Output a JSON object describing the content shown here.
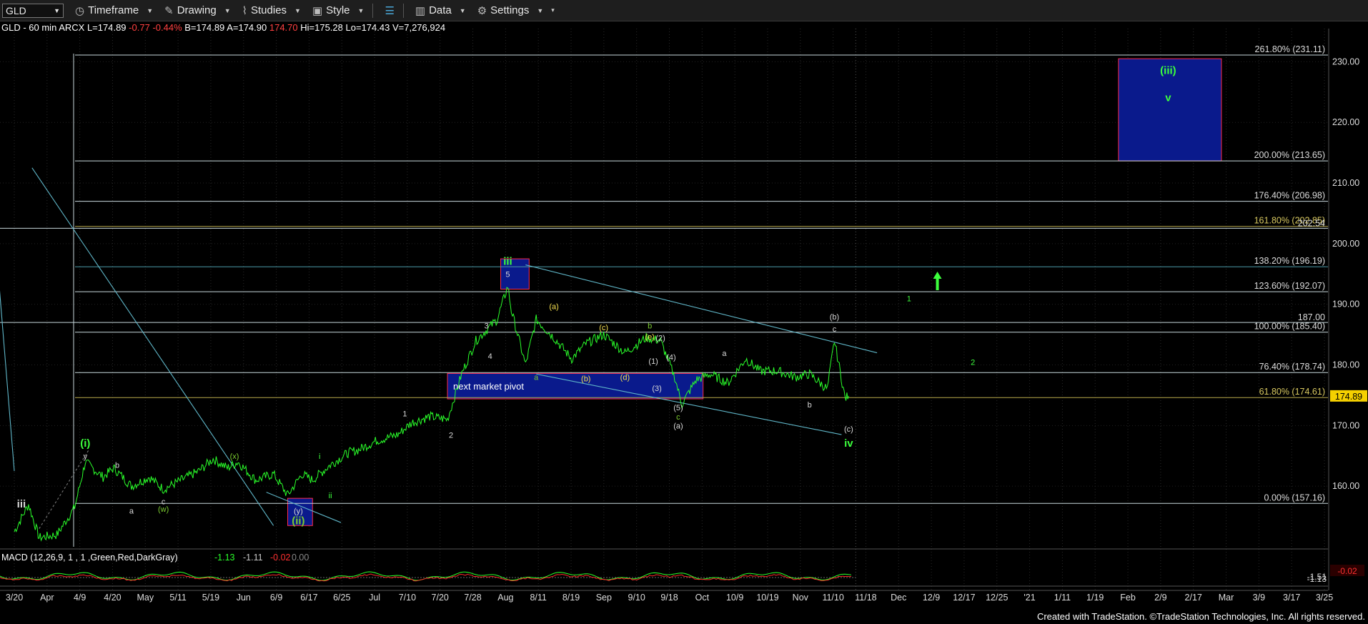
{
  "toolbar": {
    "symbol": "GLD",
    "items": [
      {
        "label": "Timeframe",
        "icon": "clock-icon"
      },
      {
        "label": "Drawing",
        "icon": "pencil-icon"
      },
      {
        "label": "Studies",
        "icon": "studies-icon"
      },
      {
        "label": "Style",
        "icon": "style-icon"
      },
      {
        "label": "Data",
        "icon": "data-icon"
      },
      {
        "label": "Settings",
        "icon": "gear-icon"
      }
    ]
  },
  "quote": {
    "symbol_interval": "GLD - 60 min  ARCX",
    "last": "L=174.89",
    "change": "-0.77",
    "change_pct": "-0.44%",
    "bid": "B=174.89",
    "ask": "A=174.90",
    "last2": "174.70",
    "high": "Hi=175.28",
    "low": "Lo=174.43",
    "volume": "V=7,276,924"
  },
  "colors": {
    "background": "#000000",
    "trendline": "#5fb6c8",
    "fib_line": "#c8d8dc",
    "fib_gold": "#b8a84a",
    "box_fill": "#0a1a8c",
    "box_border": "#ff2a4a",
    "price": "#2aff2a",
    "wave_green": "#3cff3c",
    "wave_olive": "#7ccd30",
    "wave_white": "#d8d8d8",
    "wave_yellow": "#f5e050",
    "macd_green": "#2aff2a",
    "macd_red": "#ff2a2a",
    "last_price_box": "#f5d000"
  },
  "chart_data": {
    "type": "line",
    "title": "",
    "timeframe": "60 min",
    "xlabel": "",
    "ylabel": "",
    "ylim": [
      150,
      235
    ],
    "y_ticks": [
      "160.00",
      "170.00",
      "180.00",
      "190.00",
      "200.00",
      "210.00",
      "220.00",
      "230.00"
    ],
    "x_tick_labels": [
      "3/20",
      "Apr",
      "4/9",
      "4/20",
      "May",
      "5/11",
      "5/19",
      "Jun",
      "6/9",
      "6/17",
      "6/25",
      "Jul",
      "7/10",
      "7/20",
      "7/28",
      "Aug",
      "8/11",
      "8/19",
      "Sep",
      "9/10",
      "9/18",
      "Oct",
      "10/9",
      "10/19",
      "Nov",
      "11/10",
      "11/18",
      "Dec",
      "12/9",
      "12/17",
      "12/25",
      "'21",
      "1/11",
      "1/19",
      "Feb",
      "2/9",
      "2/17",
      "Mar",
      "3/9",
      "3/17",
      "3/25"
    ],
    "last_price": "174.89",
    "series": [
      {
        "name": "GLD",
        "x": [
          "3/20",
          "3/24",
          "3/27",
          "4/1",
          "4/6",
          "4/9",
          "4/14",
          "4/17",
          "4/22",
          "4/27",
          "5/1",
          "5/6",
          "5/11",
          "5/15",
          "5/19",
          "5/22",
          "5/27",
          "6/1",
          "6/5",
          "6/9",
          "6/12",
          "6/17",
          "6/22",
          "6/25",
          "6/30",
          "7/6",
          "7/10",
          "7/15",
          "7/20",
          "7/24",
          "7/28",
          "8/3",
          "8/6",
          "8/7",
          "8/11",
          "8/14",
          "8/19",
          "8/24",
          "8/28",
          "9/2",
          "9/8",
          "9/14",
          "9/18",
          "9/22",
          "9/24",
          "9/28",
          "10/2",
          "10/7",
          "10/12",
          "10/16",
          "10/21",
          "10/26",
          "10/30",
          "11/4",
          "11/6",
          "11/9",
          "11/10"
        ],
        "values": [
          152.5,
          157.0,
          151.5,
          152.0,
          156.5,
          164.0,
          161.5,
          163.0,
          160.0,
          161.5,
          159.5,
          161.0,
          162.5,
          164.5,
          163.0,
          164.0,
          161.0,
          162.0,
          158.5,
          162.0,
          161.0,
          163.5,
          165.5,
          166.0,
          167.5,
          168.5,
          170.5,
          171.5,
          171.0,
          178.5,
          184.0,
          187.5,
          193.0,
          189.0,
          180.0,
          187.5,
          184.5,
          181.0,
          183.5,
          185.0,
          182.0,
          184.5,
          184.0,
          178.0,
          173.5,
          177.5,
          178.5,
          177.0,
          181.0,
          179.0,
          179.0,
          178.0,
          178.5,
          176.0,
          184.0,
          174.5,
          174.89
        ]
      }
    ],
    "fib_levels": [
      {
        "label": "261.80% (231.11)",
        "value": 231.11
      },
      {
        "label": "200.00% (213.65)",
        "value": 213.65
      },
      {
        "label": "176.40% (206.98)",
        "value": 206.98
      },
      {
        "label": "161.80% (202.85)",
        "value": 202.85
      },
      {
        "label": "138.20% (196.19)",
        "value": 196.19
      },
      {
        "label": "123.60% (192.07)",
        "value": 192.07
      },
      {
        "label": "100.00% (185.40)",
        "value": 185.4
      },
      {
        "label": "76.40% (178.74)",
        "value": 178.74
      },
      {
        "label": "61.80% (174.61)",
        "value": 174.61
      },
      {
        "label": "0.00% (157.16)",
        "value": 157.16
      }
    ],
    "horizontal_levels": [
      {
        "label": "202.54",
        "value": 202.54
      },
      {
        "label": "187.00",
        "value": 187.0
      }
    ],
    "boxes": [
      {
        "label": "next market pivot",
        "x_from": "7/20",
        "x_to": "9/30",
        "y_from": 174.4,
        "y_to": 178.6
      },
      {
        "label": "",
        "x_from": "8/4",
        "x_to": "8/12",
        "y_from": 192.5,
        "y_to": 197.5
      },
      {
        "label": "",
        "x_from": "6/5",
        "x_to": "6/12",
        "y_from": 153.5,
        "y_to": 158.0
      },
      {
        "label": "",
        "x_from": "1/25",
        "x_to": "2/23",
        "y_from": 213.65,
        "y_to": 230.5
      }
    ],
    "wave_labels": [
      {
        "text": "iii",
        "x": "3/22",
        "y": 156.5,
        "color": "white"
      },
      {
        "text": "(i)",
        "x": "4/9",
        "y": 166.5,
        "color": "green"
      },
      {
        "text": "y",
        "x": "4/9",
        "y": 164.5,
        "color": "white"
      },
      {
        "text": "b",
        "x": "4/18",
        "y": 163.0,
        "color": "white"
      },
      {
        "text": "a",
        "x": "4/22",
        "y": 155.5,
        "color": "white"
      },
      {
        "text": "c",
        "x": "5/1",
        "y": 157.0,
        "color": "white"
      },
      {
        "text": "(w)",
        "x": "5/1",
        "y": 155.8,
        "color": "olive"
      },
      {
        "text": "(x)",
        "x": "5/21",
        "y": 164.5,
        "color": "olive"
      },
      {
        "text": "(y)",
        "x": "6/8",
        "y": 155.5,
        "color": "white"
      },
      {
        "text": "(ii)",
        "x": "6/8",
        "y": 153.7,
        "color": "olive"
      },
      {
        "text": "i",
        "x": "6/14",
        "y": 164.5,
        "color": "green"
      },
      {
        "text": "ii",
        "x": "6/17",
        "y": 158.0,
        "color": "green"
      },
      {
        "text": "1",
        "x": "7/8",
        "y": 171.5,
        "color": "white"
      },
      {
        "text": "2",
        "x": "7/21",
        "y": 168.0,
        "color": "white"
      },
      {
        "text": "3",
        "x": "7/31",
        "y": 186.0,
        "color": "white"
      },
      {
        "text": "4",
        "x": "8/1",
        "y": 181.0,
        "color": "white"
      },
      {
        "text": "5",
        "x": "8/6",
        "y": 194.5,
        "color": "white"
      },
      {
        "text": "iii",
        "x": "8/6",
        "y": 196.5,
        "color": "green"
      },
      {
        "text": "a",
        "x": "8/14",
        "y": 177.5,
        "color": "olive"
      },
      {
        "text": "(a)",
        "x": "8/19",
        "y": 189.2,
        "color": "yellow"
      },
      {
        "text": "(b)",
        "x": "8/28",
        "y": 177.3,
        "color": "yellow"
      },
      {
        "text": "(c)",
        "x": "9/2",
        "y": 185.7,
        "color": "yellow"
      },
      {
        "text": "(d)",
        "x": "9/8",
        "y": 177.5,
        "color": "yellow"
      },
      {
        "text": "b",
        "x": "9/15",
        "y": 186.0,
        "color": "olive"
      },
      {
        "text": "(e)",
        "x": "9/15",
        "y": 184.2,
        "color": "yellow"
      },
      {
        "text": "(1)",
        "x": "9/16",
        "y": 180.2,
        "color": "white"
      },
      {
        "text": "(2)",
        "x": "9/18",
        "y": 184.0,
        "color": "white"
      },
      {
        "text": "(3)",
        "x": "9/17",
        "y": 175.7,
        "color": "white"
      },
      {
        "text": "(4)",
        "x": "9/21",
        "y": 180.8,
        "color": "white"
      },
      {
        "text": "(5)",
        "x": "9/23",
        "y": 172.5,
        "color": "white"
      },
      {
        "text": "c",
        "x": "9/23",
        "y": 171.0,
        "color": "olive"
      },
      {
        "text": "(a)",
        "x": "9/23",
        "y": 169.5,
        "color": "white"
      },
      {
        "text": "a",
        "x": "10/6",
        "y": 181.5,
        "color": "white"
      },
      {
        "text": "b",
        "x": "10/30",
        "y": 173.0,
        "color": "white"
      },
      {
        "text": "c",
        "x": "11/6",
        "y": 185.5,
        "color": "white"
      },
      {
        "text": "(b)",
        "x": "11/6",
        "y": 187.5,
        "color": "white"
      },
      {
        "text": "(c)",
        "x": "11/10",
        "y": 169.0,
        "color": "white"
      },
      {
        "text": "iv",
        "x": "11/10",
        "y": 166.5,
        "color": "green"
      },
      {
        "text": "1",
        "x": "11/27",
        "y": 190.5,
        "color": "green"
      },
      {
        "text": "2",
        "x": "12/15",
        "y": 180.0,
        "color": "green"
      },
      {
        "text": "(iii)",
        "x": "2/8",
        "y": 228.0,
        "color": "green"
      },
      {
        "text": "v",
        "x": "2/8",
        "y": 223.5,
        "color": "green"
      }
    ]
  },
  "macd": {
    "label": "MACD (12,26,9, 1 , 1 ,Green,Red,DarkGray)",
    "value1": "-1.13",
    "value2": "-1.11",
    "value3": "-0.02",
    "value4": "0.00",
    "axis_labels": [
      "-1.51",
      "-1.13",
      "-0.02"
    ]
  },
  "footer": "Created with TradeStation. ©TradeStation Technologies, Inc. All rights reserved."
}
